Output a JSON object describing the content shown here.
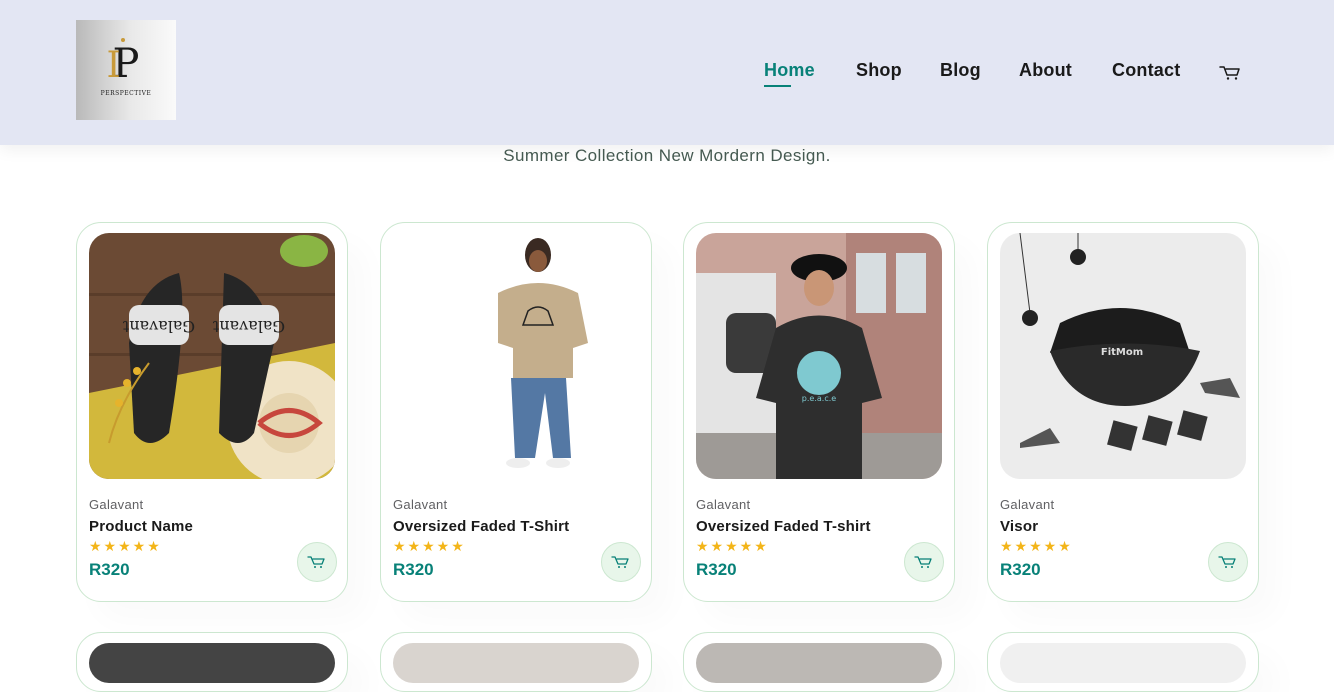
{
  "header": {
    "logo": {
      "mark": "P",
      "word": "PERSPECTIVE"
    },
    "nav": [
      {
        "label": "Home",
        "active": true
      },
      {
        "label": "Shop",
        "active": false
      },
      {
        "label": "Blog",
        "active": false
      },
      {
        "label": "About",
        "active": false
      },
      {
        "label": "Contact",
        "active": false
      }
    ],
    "cart_icon": "cart-icon"
  },
  "section": {
    "subtitle": "Summer Collection New Mordern Design."
  },
  "products": [
    {
      "brand": "Galavant",
      "name": "Product Name",
      "rating": 5,
      "price": "R320",
      "image": "slides-sandals"
    },
    {
      "brand": "Galavant",
      "name": "Oversized Faded T-Shirt",
      "rating": 5,
      "price": "R320",
      "image": "beige-tshirt-model"
    },
    {
      "brand": "Galavant",
      "name": "Oversized Faded T-shirt",
      "rating": 5,
      "price": "R320",
      "image": "black-tshirt-model"
    },
    {
      "brand": "Galavant",
      "name": "Visor",
      "rating": 5,
      "price": "R320",
      "image": "black-visor"
    }
  ],
  "stars_glyph": "★★★★★",
  "colors": {
    "accent": "#088178",
    "header_bg": "#e3e6f3",
    "star": "#f3b519",
    "card_border": "#cce7d0"
  }
}
